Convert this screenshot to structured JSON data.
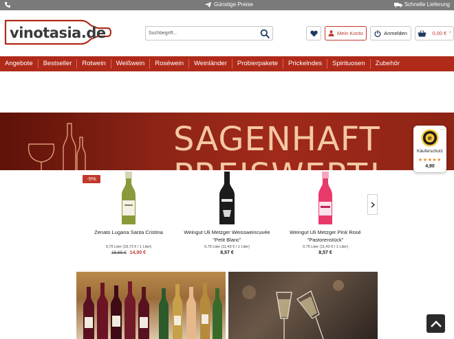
{
  "topbar": {
    "center_text": "Günstige Preise",
    "right_text": "Schnelle Lieferung"
  },
  "header": {
    "logo_text": "vinotasia.de",
    "search_placeholder": "Suchbegriff...",
    "konto_label": "Mein Konto",
    "anmelden_label": "Anmelden",
    "cart_total": "0,00 €",
    "cart_star": "*"
  },
  "nav": {
    "items": [
      "Angebote",
      "Bestseller",
      "Rotwein",
      "Weißwein",
      "Roséwein",
      "Weinländer",
      "Probierpakete",
      "Prickelndes",
      "Spirituosen",
      "Zubehör"
    ]
  },
  "banner": {
    "headline_line1": "SAGENHAFT",
    "headline_line2": "PREISWERT!"
  },
  "trust_badge": {
    "label": "Käuferschutz",
    "stars": "★★★★★",
    "rating": "4,90",
    "menu": "..."
  },
  "products": [
    {
      "name": "Zenato Lugana Santa Cristina",
      "name_line2": "",
      "size_info": "0,75 Liter (18,73 € / 1 Liter)",
      "old_price": "15,65 €",
      "price": "14,00 €",
      "badge": "-5%"
    },
    {
      "name": "Weingut Uli Metzger Weissweincuvée",
      "name_line2": "\"Petit Blanc\"",
      "size_info": "0,75 Liter (11,43 € / 1 Liter)",
      "old_price": "",
      "price": "8,57 €",
      "badge": ""
    },
    {
      "name": "Weingut Uli Metzger Pink Rosé",
      "name_line2": "\"Pastorenstück\"",
      "size_info": "0,75 Liter (11,43 € / 1 Liter)",
      "old_price": "",
      "price": "8,57 €",
      "badge": ""
    }
  ],
  "colors": {
    "brand_red": "#b02a19",
    "price_red": "#c0392b",
    "topbar_grey": "#7a7a7a"
  },
  "icons": [
    "phone-icon",
    "paper-plane-icon",
    "truck-icon",
    "search-icon",
    "heart-icon",
    "user-icon",
    "power-icon",
    "basket-icon",
    "chevron-right-icon",
    "chevron-up-icon"
  ]
}
